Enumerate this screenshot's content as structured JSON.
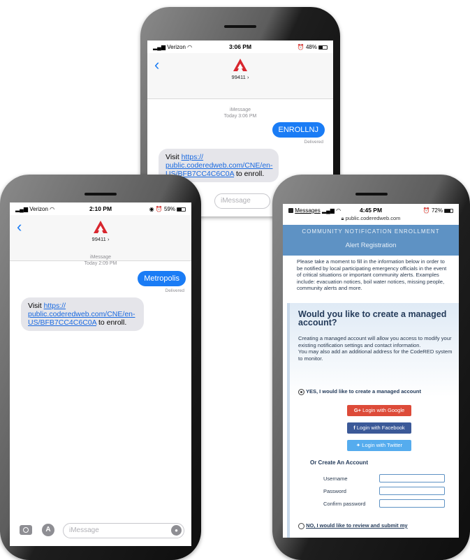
{
  "phone_top": {
    "carrier": "Verizon",
    "time": "3:06 PM",
    "battery": "48%",
    "sender": "99411",
    "meta_service": "iMessage",
    "meta_time": "Today 3:06 PM",
    "outgoing": "ENROLLNJ",
    "delivered": "Delivered",
    "incoming_prefix": "Visit ",
    "incoming_link": "https://\npublic.coderedweb.com/CNE/en-US/BFB7CC4C6C0A",
    "incoming_suffix": " to enroll.",
    "input_placeholder": "iMessage"
  },
  "phone_left": {
    "carrier": "Verizon",
    "time": "2:10 PM",
    "battery": "59%",
    "sender": "99411",
    "meta_service": "iMessage",
    "meta_time": "Today 2:09 PM",
    "outgoing": "Metropolis",
    "delivered": "Delivered",
    "incoming_prefix": "Visit ",
    "incoming_link": "https://\npublic.coderedweb.com/CNE/en-US/BFB7CC4C6C0A",
    "incoming_suffix": " to enroll.",
    "input_placeholder": "iMessage"
  },
  "phone_right": {
    "back_app": "Messages",
    "time": "4:45 PM",
    "battery": "72%",
    "url": "public.coderedweb.com",
    "banner_title": "COMMUNITY NOTIFICATION ENROLLMENT",
    "banner_sub": "Alert Registration",
    "intro": "Please take a moment to fill in the information below in order to be notified by local participating emergency officials in the event of critical situations or important community alerts. Examples include: evacuation notices, boil water notices, missing people, community alerts and more.",
    "heading": "Would you like to create a managed account?",
    "managed_desc": "Creating a managed account will allow you access to modify your existing notification settings and contact information.\nYou may also add an additional address for the CodeRED system to monitor.",
    "yes_option": "YES, I would like to create a managed account",
    "google_btn": "Login with Google",
    "facebook_btn": "Login with Facebook",
    "twitter_btn": "Login with Twitter",
    "or_create": "Or Create An Account",
    "username_label": "Username",
    "password_label": "Password",
    "confirm_label": "Confirm password",
    "no_option": "NO, I would like to review and submit my"
  },
  "colors": {
    "imessage_blue": "#1a7cf5",
    "banner_blue": "#5e92c4",
    "google_red": "#dd4b39",
    "facebook_blue": "#3b5998",
    "twitter_blue": "#55acee",
    "codered_red": "#d8262e"
  },
  "icons": [
    "back-chevron-icon",
    "codered-logo-icon",
    "camera-icon",
    "appstore-icon",
    "microphone-icon",
    "wifi-icon",
    "battery-icon",
    "lock-icon",
    "radio-button-icon"
  ]
}
